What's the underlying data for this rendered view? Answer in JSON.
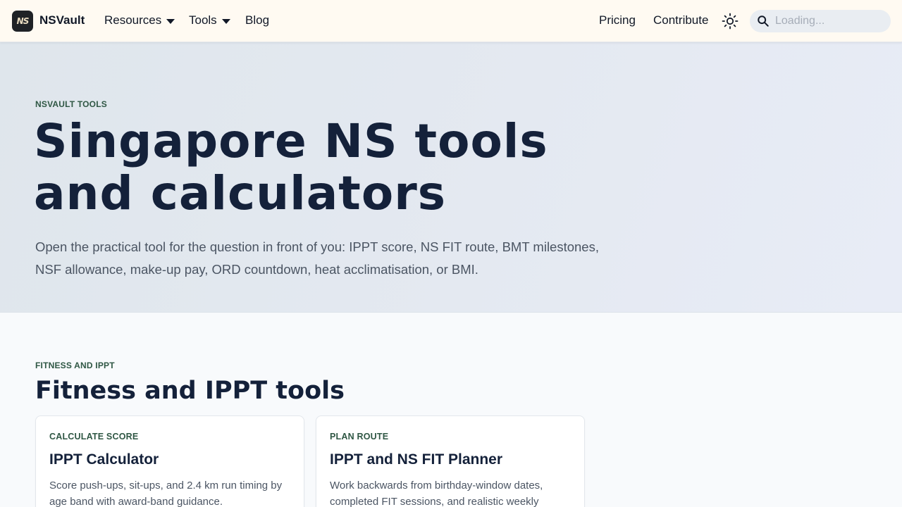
{
  "header": {
    "logo_text": "NS",
    "brand": "NSVault",
    "nav": [
      {
        "label": "Resources",
        "has_dropdown": true
      },
      {
        "label": "Tools",
        "has_dropdown": true
      },
      {
        "label": "Blog",
        "has_dropdown": false
      }
    ],
    "right_nav": [
      {
        "label": "Pricing"
      },
      {
        "label": "Contribute"
      }
    ],
    "theme_icon": "sun-icon",
    "search": {
      "placeholder": "Loading...",
      "value": "",
      "icon": "search-icon"
    }
  },
  "hero": {
    "eyebrow": "NSVAULT TOOLS",
    "title_line1": "Singapore NS tools",
    "title_line2": "and calculators",
    "description_line1": "Open the practical tool for the question in front of you: IPPT score, NS FIT route, BMT milestones,",
    "description_line2": "NSF allowance, make-up pay, ORD countdown, heat acclimatisation, or BMI."
  },
  "section": {
    "eyebrow": "FITNESS AND IPPT",
    "title": "Fitness and IPPT tools",
    "cards": [
      {
        "eyebrow": "CALCULATE SCORE",
        "title": "IPPT Calculator",
        "desc_line1": "Score push-ups, sit-ups, and 2.4 km run timing by",
        "desc_line2": "age band with award-band guidance."
      },
      {
        "eyebrow": "PLAN ROUTE",
        "title": "IPPT and NS FIT Planner",
        "desc_line1": "Work backwards from birthday-window dates,",
        "desc_line2": "completed FIT sessions, and realistic weekly"
      }
    ]
  },
  "colors": {
    "header_bg": "#fffaf2",
    "eyebrow_green": "#2f5744",
    "title_navy": "#14213a",
    "body_gray": "#4b5563"
  }
}
